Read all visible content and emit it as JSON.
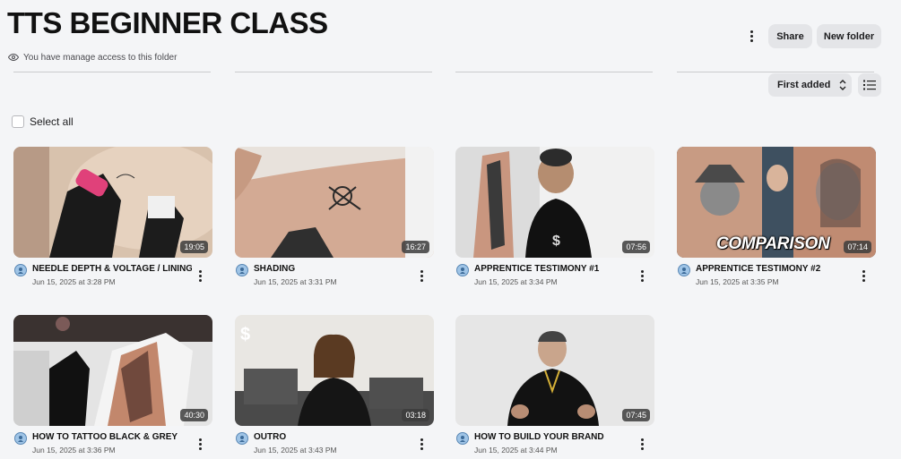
{
  "header": {
    "title": "TTS BEGINNER CLASS",
    "access_text": "You have manage access to this folder",
    "share_label": "Share",
    "new_folder_label": "New folder"
  },
  "toolbar": {
    "sort_label": "First added",
    "select_all_label": "Select all"
  },
  "videos": [
    {
      "title": "NEEDLE DEPTH & VOLTAGE / LINING",
      "date": "Jun 15, 2025 at 3:28 PM",
      "duration": "19:05"
    },
    {
      "title": "SHADING",
      "date": "Jun 15, 2025 at 3:31 PM",
      "duration": "16:27"
    },
    {
      "title": "APPRENTICE TESTIMONY #1",
      "date": "Jun 15, 2025 at 3:34 PM",
      "duration": "07:56"
    },
    {
      "title": "APPRENTICE TESTIMONY #2",
      "date": "Jun 15, 2025 at 3:35 PM",
      "duration": "07:14",
      "overlay_text": "COMPARISON"
    },
    {
      "title": "HOW TO TATTOO BLACK & GREY",
      "date": "Jun 15, 2025 at 3:36 PM",
      "duration": "40:30"
    },
    {
      "title": "OUTRO",
      "date": "Jun 15, 2025 at 3:43 PM",
      "duration": "03:18"
    },
    {
      "title": "HOW TO BUILD YOUR BRAND",
      "date": "Jun 15, 2025 at 3:44 PM",
      "duration": "07:45"
    }
  ],
  "icons": {
    "access": "eye-icon",
    "more": "more-vertical-icon",
    "sort": "sort-arrows-icon",
    "list_view": "list-view-icon",
    "avatar": "user-avatar-icon"
  },
  "colors": {
    "background": "#f4f5f7",
    "button_bg": "#e4e5e8",
    "avatar": "#9fc4e6"
  }
}
